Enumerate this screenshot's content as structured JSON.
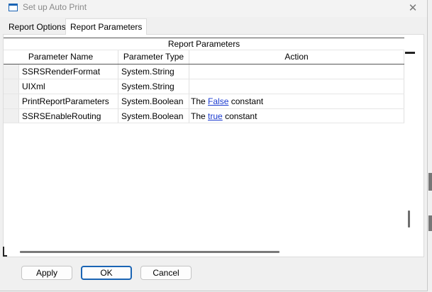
{
  "window": {
    "title": "Set up Auto Print",
    "close_glyph": "✕"
  },
  "tabs": [
    {
      "label": "Report Options",
      "active": false
    },
    {
      "label": "Report Parameters",
      "active": true
    }
  ],
  "grid": {
    "caption": "Report Parameters",
    "columns": [
      "Parameter Name",
      "Parameter Type",
      "Action"
    ],
    "rows": [
      {
        "name": "SSRSRenderFormat",
        "type": "System.String",
        "action": null
      },
      {
        "name": "UIXml",
        "type": "System.String",
        "action": null
      },
      {
        "name": "PrintReportParameters",
        "type": "System.Boolean",
        "action": {
          "prefix": "The",
          "link": "False",
          "suffix": "constant"
        }
      },
      {
        "name": "SSRSEnableRouting",
        "type": "System.Boolean",
        "action": {
          "prefix": "The",
          "link": "true",
          "suffix": "constant"
        }
      }
    ]
  },
  "buttons": {
    "apply": "Apply",
    "ok": "OK",
    "cancel": "Cancel"
  },
  "colors": {
    "accent": "#1a64b4",
    "link": "#1a3ad0"
  }
}
